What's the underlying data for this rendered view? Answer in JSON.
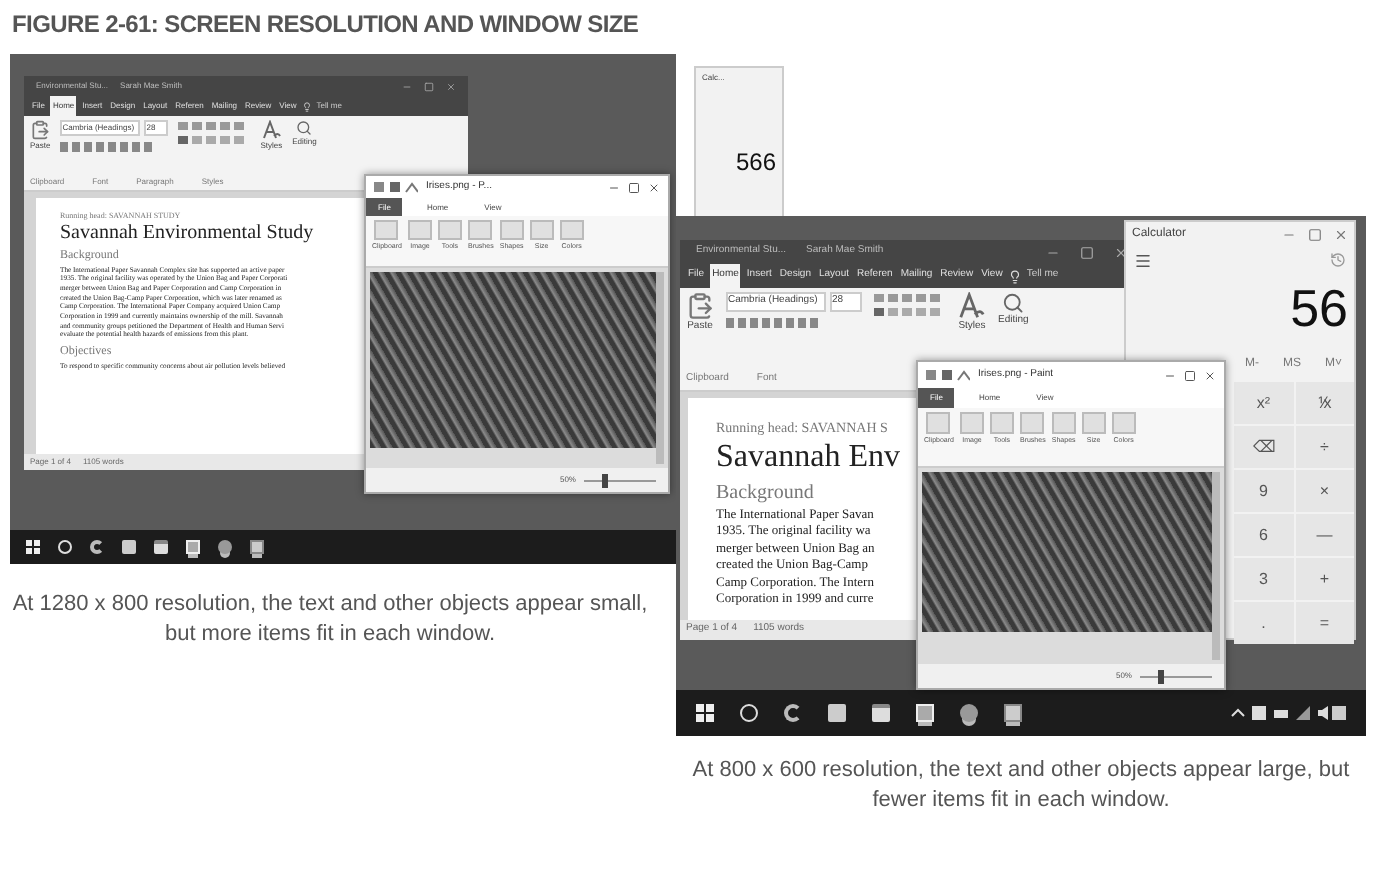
{
  "figure_title": "FIGURE 2-61: SCREEN RESOLUTION AND WINDOW SIZE",
  "screens": [
    {
      "kind": "small",
      "word": {
        "title": "Environmental Stu...",
        "user": "Sarah Mae Smith",
        "tabs": [
          {
            "label": "File",
            "selected": false
          },
          {
            "label": "Home",
            "selected": true
          },
          {
            "label": "Insert",
            "selected": false
          },
          {
            "label": "Design",
            "selected": false
          },
          {
            "label": "Layout",
            "selected": false
          },
          {
            "label": "Referen",
            "selected": false
          },
          {
            "label": "Mailing",
            "selected": false
          },
          {
            "label": "Review",
            "selected": false
          },
          {
            "label": "View",
            "selected": false
          }
        ],
        "tell_me": "Tell me",
        "paste": "Paste",
        "font": "Cambria (Headings)",
        "size": "28",
        "styles": "Styles",
        "editing": "Editing",
        "groups": [
          "Clipboard",
          "Font",
          "Paragraph",
          "Styles"
        ],
        "running_head": "Running head: SAVANNAH STUDY",
        "heading": "Savannah Environmental Study",
        "subheading": "Background",
        "paragraph": [
          "The International Paper Savannah Complex site has supported an active paper",
          "1935. The original facility was operated by the Union Bag and Paper Corporati",
          "merger between Union Bag and Paper Corporation and Camp Corporation in",
          "created the Union Bag-Camp Paper Corporation, which was later renamed as",
          "Camp Corporation. The International Paper Company acquired Union Camp",
          "Corporation in 1999 and currently maintains ownership of the mill. Savannah",
          "and community groups petitioned the Department of Health and Human Servi",
          "evaluate the potential health hazards of emissions from this plant."
        ],
        "subheading2": "Objectives",
        "paragraph2": [
          "To respond to specific community concerns about air pollution levels believed"
        ],
        "page": "Page 1 of 4",
        "words": "1105 words"
      },
      "paint": {
        "title": "Irises.png - P...",
        "tabs": [
          {
            "label": "File",
            "selected": true
          },
          {
            "label": "Home",
            "selected": false
          },
          {
            "label": "View",
            "selected": false
          }
        ],
        "tools": [
          "Clipboard",
          "Image",
          "Tools",
          "Brushes",
          "Shapes",
          "Size",
          "Colors"
        ],
        "zoom": "50%",
        "zoom_slider": {
          "level": 0.3
        }
      },
      "calculator": {
        "title": "Calc...",
        "display": "566"
      },
      "taskbar": [
        {
          "kind": "start",
          "open": false
        },
        {
          "kind": "search",
          "open": false
        },
        {
          "kind": "browser",
          "open": false
        },
        {
          "kind": "folder",
          "open": false
        },
        {
          "kind": "store",
          "open": false
        },
        {
          "kind": "word",
          "open": true
        },
        {
          "kind": "paint",
          "open": true
        },
        {
          "kind": "calculator",
          "open": true
        }
      ],
      "tray": false,
      "caption": "At 1280 x 800 resolution, the text and other objects appear small, but more items fit in each window."
    },
    {
      "kind": "large",
      "word": {
        "title": "Environmental Stu...",
        "user": "Sarah Mae Smith",
        "tabs": [
          {
            "label": "File",
            "selected": false
          },
          {
            "label": "Home",
            "selected": true
          },
          {
            "label": "Insert",
            "selected": false
          },
          {
            "label": "Design",
            "selected": false
          },
          {
            "label": "Layout",
            "selected": false
          },
          {
            "label": "Referen",
            "selected": false
          },
          {
            "label": "Mailing",
            "selected": false
          },
          {
            "label": "Review",
            "selected": false
          },
          {
            "label": "View",
            "selected": false
          }
        ],
        "tell_me": "Tell me",
        "paste": "Paste",
        "font": "Cambria (Headings)",
        "size": "28",
        "styles": "Styles",
        "editing": "Editing",
        "groups": [
          "Clipboard",
          "Font"
        ],
        "running_head": "Running head: SAVANNAH S",
        "heading": "Savannah Env",
        "subheading": "Background",
        "paragraph": [
          "The International Paper Savan",
          "1935. The original facility wa",
          "merger between Union Bag an",
          "created the Union Bag-Camp",
          "Camp Corporation. The Intern",
          "Corporation in 1999 and curre"
        ],
        "page": "Page 1 of 4",
        "words": "1105 words"
      },
      "paint": {
        "title": "Irises.png - Paint",
        "tabs": [
          {
            "label": "File",
            "selected": true
          },
          {
            "label": "Home",
            "selected": false
          },
          {
            "label": "View",
            "selected": false
          }
        ],
        "tools": [
          "Clipboard",
          "Image",
          "Tools",
          "Brushes",
          "Shapes",
          "Size",
          "Colors"
        ],
        "zoom": "50%",
        "zoom_slider": {
          "level": 0.3
        }
      },
      "calculator": {
        "title": "Calculator",
        "display": "56",
        "memory": [
          "M-",
          "MS",
          "M˅"
        ],
        "keys": [
          "x²",
          "⅟x",
          "⌫",
          "÷",
          "9",
          "×",
          "6",
          "—",
          "3",
          "+",
          ".",
          "="
        ]
      },
      "taskbar": [
        {
          "kind": "start",
          "open": false
        },
        {
          "kind": "search",
          "open": false
        },
        {
          "kind": "browser",
          "open": false
        },
        {
          "kind": "folder",
          "open": false
        },
        {
          "kind": "store",
          "open": false
        },
        {
          "kind": "word",
          "open": true
        },
        {
          "kind": "paint",
          "open": true
        },
        {
          "kind": "calculator",
          "open": true
        }
      ],
      "tray": true,
      "caption": "At 800 x 600 resolution, the text and other objects appear large, but fewer items fit in each window."
    }
  ]
}
